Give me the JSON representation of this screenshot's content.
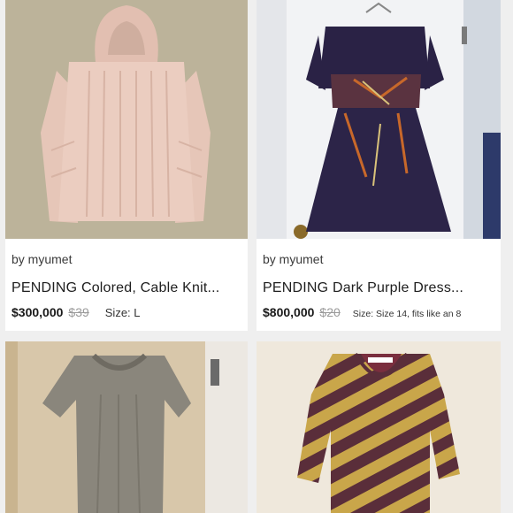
{
  "listings": [
    {
      "seller": "by myumet",
      "title": "PENDING Colored, Cable Knit...",
      "price": "$300,000",
      "original_price": "$39",
      "size": "Size: L",
      "image_icon": "pink-hooded-sweater-photo"
    },
    {
      "seller": "by myumet",
      "title": "PENDING Dark Purple Dress...",
      "price": "$800,000",
      "original_price": "$20",
      "size": "Size: Size 14, fits like an 8",
      "image_icon": "dark-purple-dress-photo"
    },
    {
      "image_icon": "gray-velvet-top-photo"
    },
    {
      "image_icon": "striped-yellow-purple-top-photo"
    }
  ],
  "colors": {
    "background": "#efefef",
    "card": "#ffffff",
    "sweater": "#e8c9bb",
    "dress": "#2a2245",
    "velvet": "#8a867c",
    "stripe_yellow": "#c9a64a",
    "stripe_purple": "#5a2e3a"
  }
}
